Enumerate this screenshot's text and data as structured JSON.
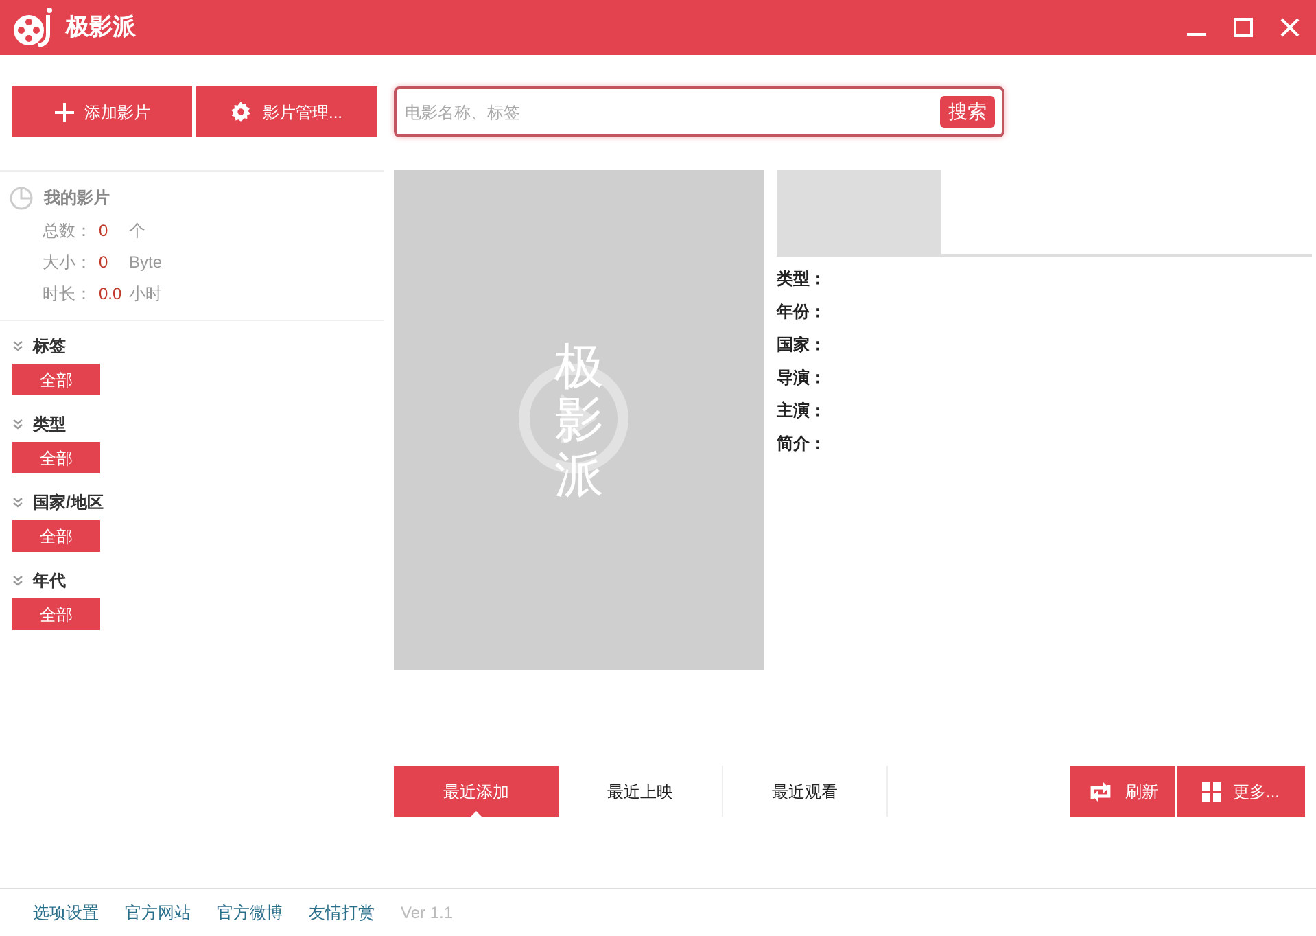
{
  "window": {
    "title": "极影派"
  },
  "toolbar": {
    "buttons": [
      {
        "kind": "add",
        "label": "添加影片"
      },
      {
        "kind": "manage",
        "label": "影片管理..."
      }
    ]
  },
  "search": {
    "placeholder": "电影名称、标签",
    "button": "搜索"
  },
  "library": {
    "title": "我的影片",
    "stats": [
      {
        "label": "总数：",
        "value": "0",
        "unit": "个"
      },
      {
        "label": "大小：",
        "value": "0",
        "unit": "Byte"
      },
      {
        "label": "时长：",
        "value": "0.0",
        "unit": "小时"
      }
    ]
  },
  "filters": [
    {
      "title": "标签",
      "expanded": true,
      "option": "全部"
    },
    {
      "title": "类型",
      "expanded": true,
      "option": "全部"
    },
    {
      "title": "国家/地区",
      "expanded": true,
      "option": "全部"
    },
    {
      "title": "年代",
      "expanded": true,
      "option": "全部"
    }
  ],
  "poster": {
    "text": "极影派"
  },
  "details": [
    "类型：",
    "年份：",
    "国家：",
    "导演：",
    "主演：",
    "简介："
  ],
  "tabs": [
    {
      "label": "最近添加",
      "selected": true
    },
    {
      "label": "最近上映",
      "selected": false
    },
    {
      "label": "最近观看",
      "selected": false
    }
  ],
  "actions": [
    {
      "kind": "refresh",
      "label": "刷新"
    },
    {
      "kind": "more",
      "label": "更多..."
    }
  ],
  "footer": {
    "links": [
      "选项设置",
      "官方网站",
      "官方微博",
      "友情打赏"
    ],
    "version": "Ver 1.1"
  }
}
